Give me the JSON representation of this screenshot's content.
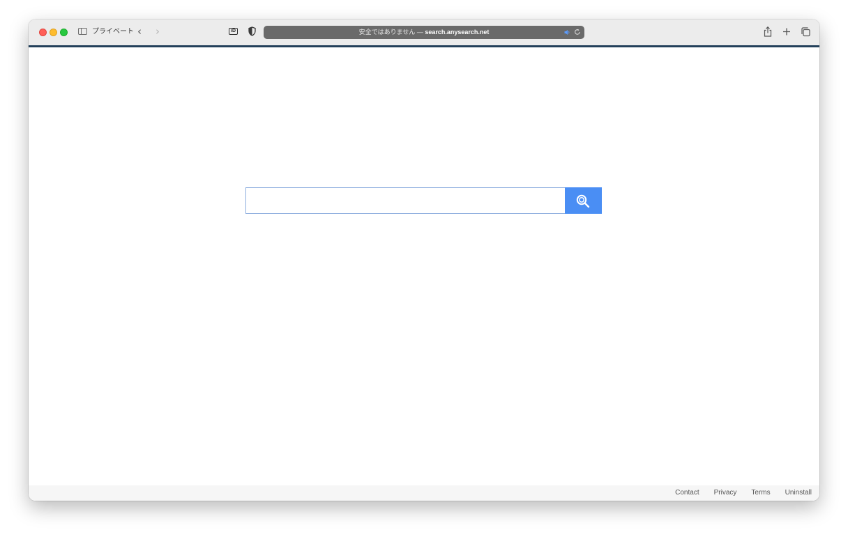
{
  "browser": {
    "private_label": "プライベート",
    "address": {
      "insecure_prefix": "安全ではありません —",
      "host": "search.anysearch.net"
    },
    "id_badge": "iD",
    "accent_color": "#23405a"
  },
  "search": {
    "input_value": "",
    "button_color": "#4a8ef4",
    "button_icon": "search-icon"
  },
  "footer": {
    "links": [
      "Contact",
      "Privacy",
      "Terms",
      "Uninstall"
    ]
  }
}
